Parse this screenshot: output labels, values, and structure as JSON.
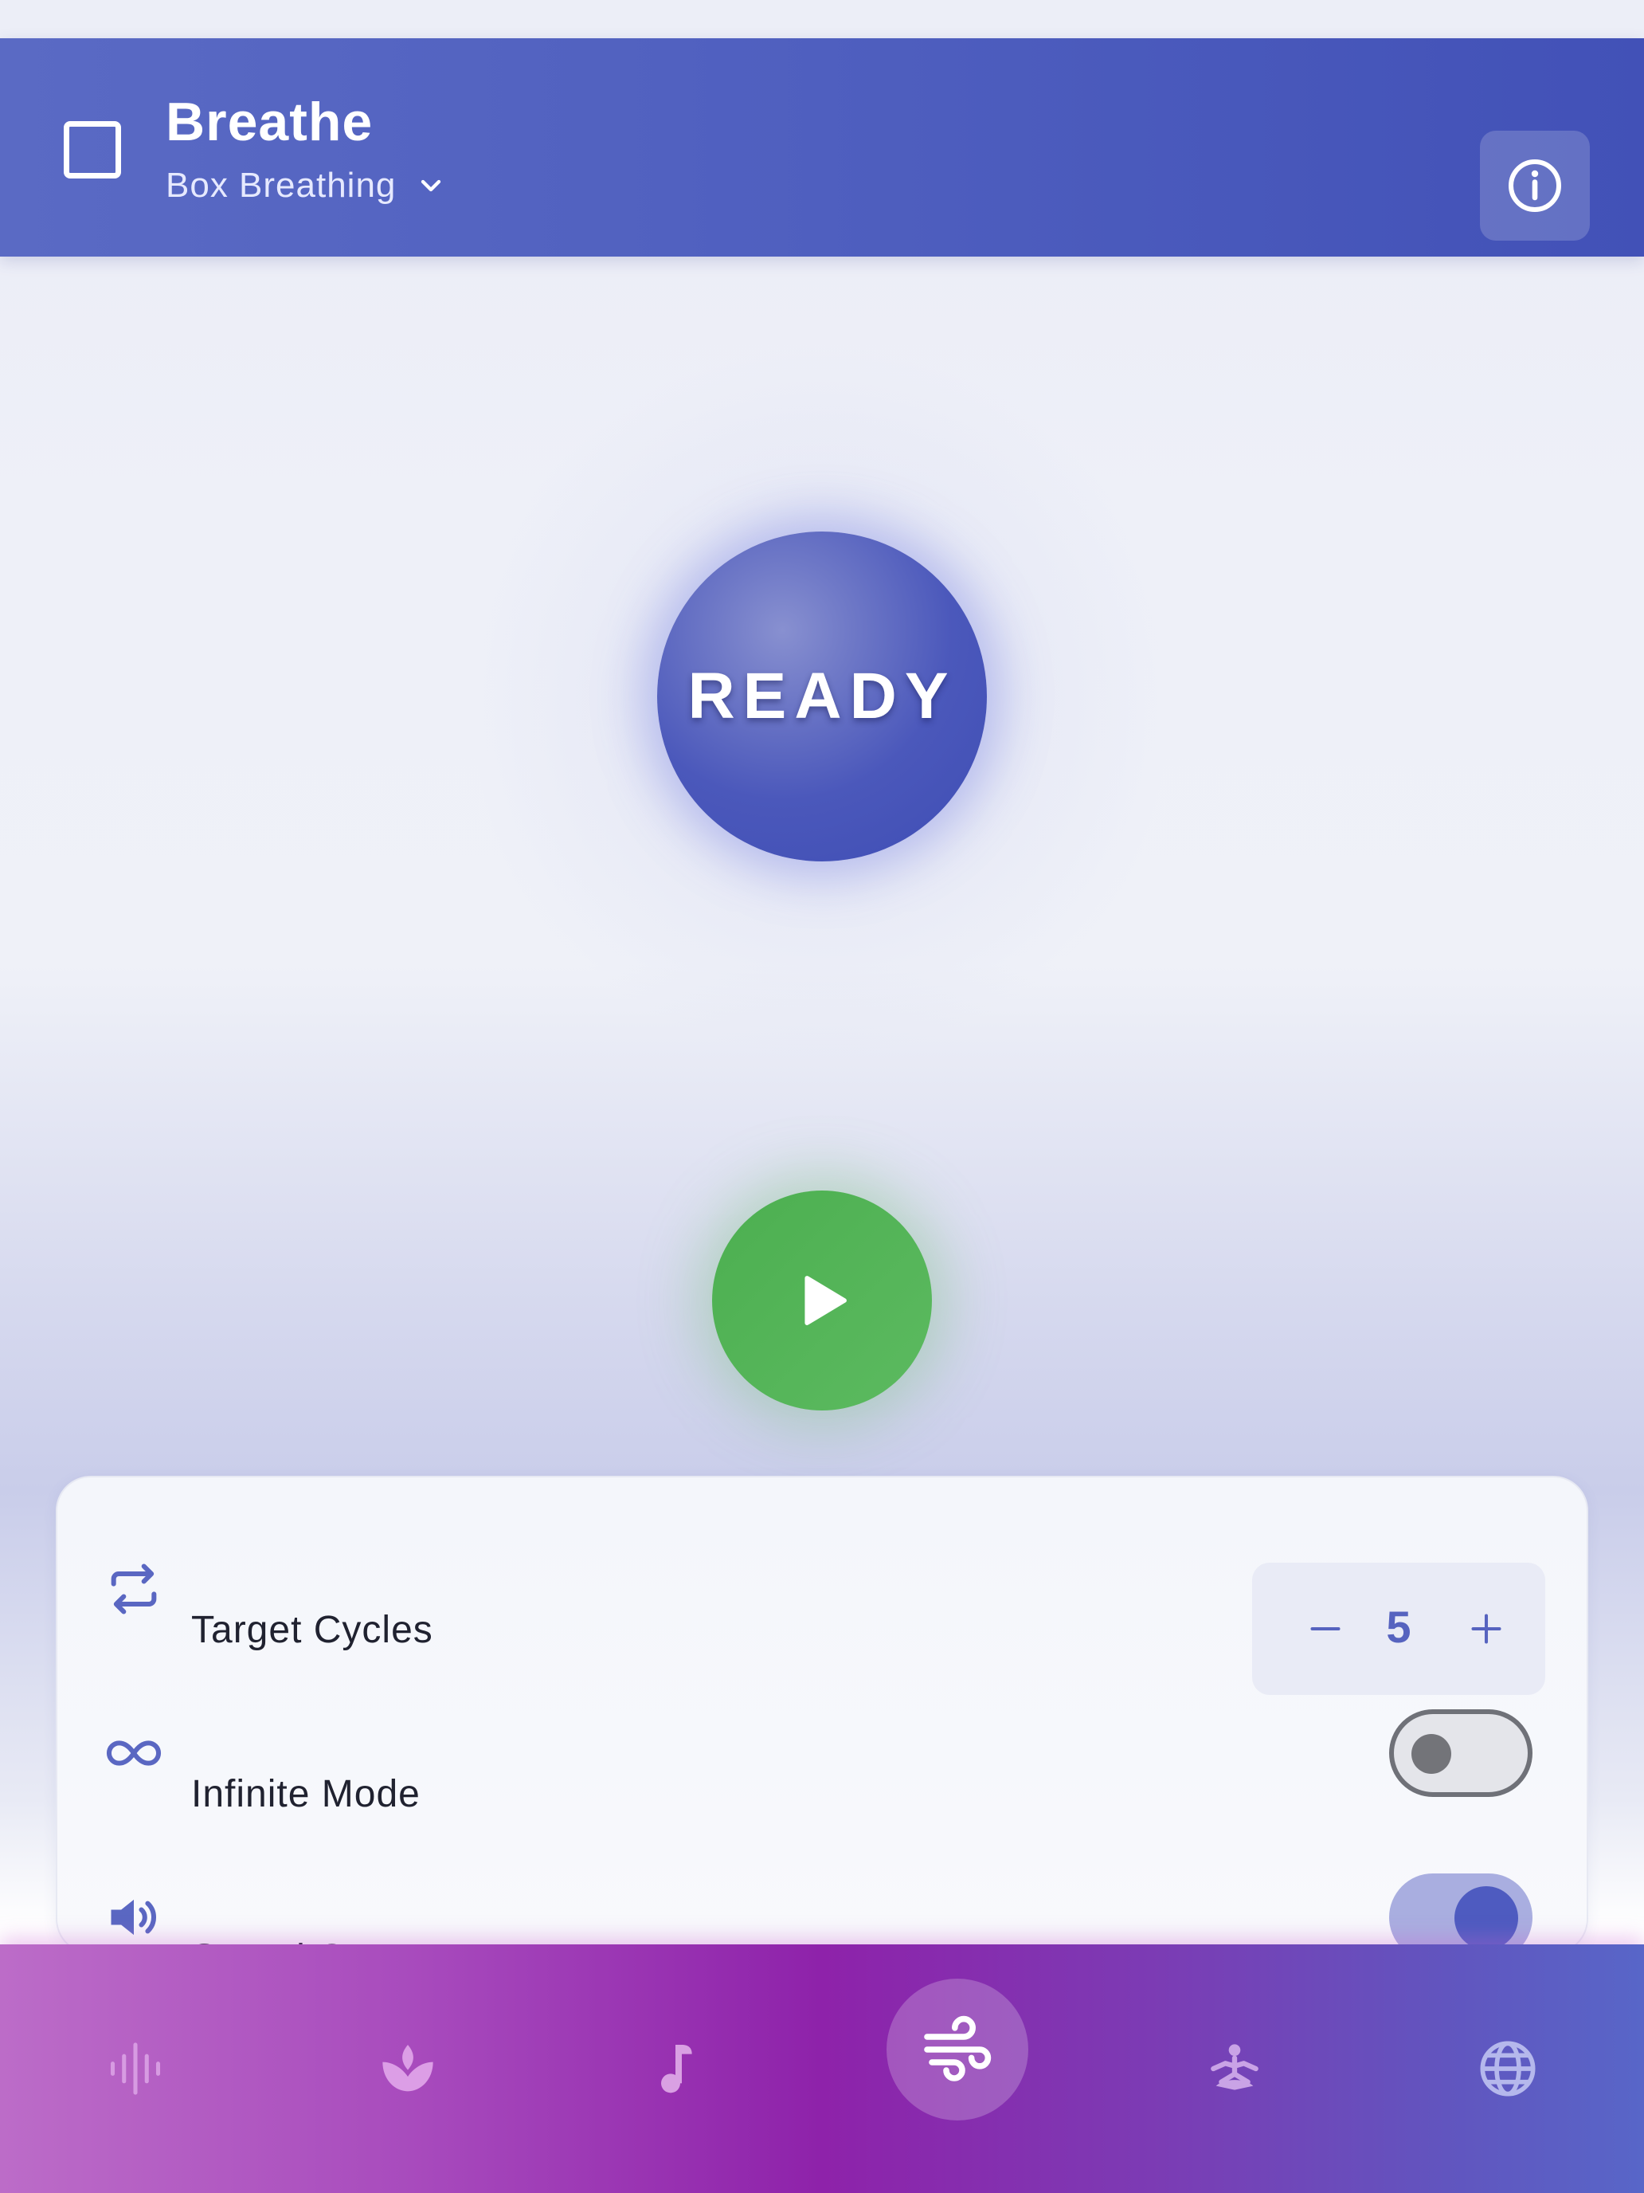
{
  "header": {
    "title": "Breathe",
    "mode": "Box Breathing"
  },
  "orb": {
    "status": "READY"
  },
  "settings": {
    "target_cycles_label": "Target Cycles",
    "target_cycles_value": "5",
    "infinite_mode_label": "Infinite Mode",
    "infinite_mode_on": false,
    "sound_cues_label": "Sound Cues",
    "sound_cues_on": true
  },
  "nav": {
    "items": [
      "waveform-icon",
      "lotus-icon",
      "music-note-icon",
      "wind-icon",
      "meditation-icon",
      "globe-icon"
    ],
    "active": "wind-icon"
  },
  "colors": {
    "header": "#4f5fbf",
    "orb": "#4b58bb",
    "play": "#4caf50",
    "accent": "#5663bf",
    "nav_center": "#8e22aa"
  }
}
